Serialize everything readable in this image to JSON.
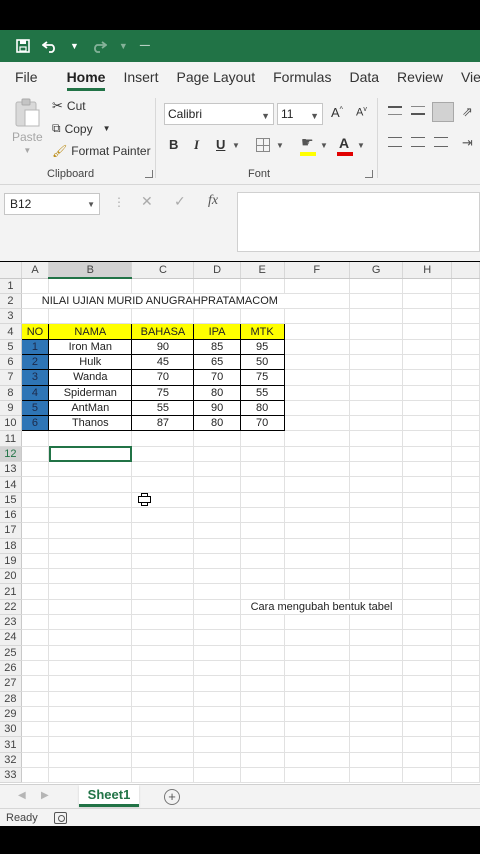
{
  "quick_access": {
    "items": [
      {
        "name": "save-icon"
      },
      {
        "name": "undo-icon"
      },
      {
        "name": "redo-icon"
      },
      {
        "name": "customize-qat-icon"
      }
    ]
  },
  "ribbon_tabs": [
    "File",
    "Home",
    "Insert",
    "Page Layout",
    "Formulas",
    "Data",
    "Review",
    "View"
  ],
  "active_tab": "Home",
  "clipboard": {
    "paste_label": "Paste",
    "cut_label": "Cut",
    "copy_label": "Copy",
    "format_painter_label": "Format Painter",
    "group_label": "Clipboard"
  },
  "font": {
    "family": "Calibri",
    "size": "11",
    "group_label": "Font",
    "bold": "B",
    "italic": "I",
    "underline": "U",
    "grow": "A",
    "shrink": "A"
  },
  "formula_bar": {
    "name_box": "B12",
    "fx": "fx",
    "value": ""
  },
  "grid": {
    "columns": [
      "A",
      "B",
      "C",
      "D",
      "E",
      "F",
      "G",
      "H"
    ],
    "selected_column": "B",
    "selected_row": 12,
    "title": "NILAI UJIAN MURID ANUGRAHPRATAMACOM",
    "headers": [
      "NO",
      "NAMA",
      "BAHASA",
      "IPA",
      "MTK"
    ],
    "rows": [
      [
        "1",
        "Iron Man",
        "90",
        "85",
        "95"
      ],
      [
        "2",
        "Hulk",
        "45",
        "65",
        "50"
      ],
      [
        "3",
        "Wanda",
        "70",
        "70",
        "75"
      ],
      [
        "4",
        "Spiderman",
        "75",
        "80",
        "55"
      ],
      [
        "5",
        "AntMan",
        "55",
        "90",
        "80"
      ],
      [
        "6",
        "Thanos",
        "87",
        "80",
        "70"
      ]
    ],
    "caption": "Cara mengubah bentuk tabel",
    "row_count": 33
  },
  "sheet_tabs": {
    "active": "Sheet1",
    "add": "+"
  },
  "status": {
    "text": "Ready"
  },
  "colors": {
    "excel_green": "#217346",
    "header_yellow": "#ffff00",
    "number_blue": "#2e75b6"
  }
}
